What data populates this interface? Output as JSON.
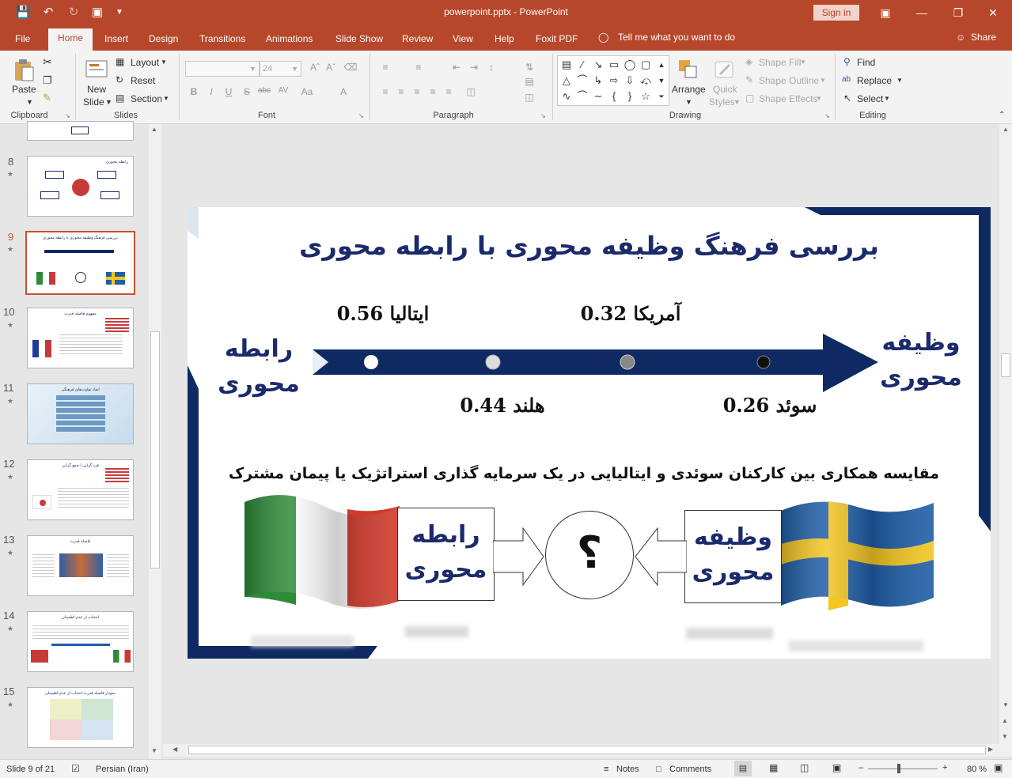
{
  "window": {
    "title": "powerpoint.pptx  -  PowerPoint",
    "signin_label": "Sign in"
  },
  "tabs": [
    "File",
    "Home",
    "Insert",
    "Design",
    "Transitions",
    "Animations",
    "Slide Show",
    "Review",
    "View",
    "Help",
    "Foxit PDF"
  ],
  "active_tab": "Home",
  "tell_me": "Tell me what you want to do",
  "share_label": "Share",
  "ribbon": {
    "clipboard": {
      "label": "Clipboard",
      "paste": "Paste"
    },
    "slides": {
      "label": "Slides",
      "new_slide_line1": "New",
      "new_slide_line2": "Slide",
      "layout": "Layout",
      "reset": "Reset",
      "section": "Section"
    },
    "font": {
      "label": "Font",
      "size": "24"
    },
    "paragraph": {
      "label": "Paragraph"
    },
    "drawing": {
      "label": "Drawing",
      "arrange": "Arrange",
      "quick_styles_line1": "Quick",
      "quick_styles_line2": "Styles",
      "shape_fill": "Shape Fill",
      "shape_outline": "Shape Outline",
      "shape_effects": "Shape Effects"
    },
    "editing": {
      "label": "Editing",
      "find": "Find",
      "replace": "Replace",
      "select": "Select"
    }
  },
  "thumbnails": [
    {
      "num": "8",
      "title": "رابطه محوری"
    },
    {
      "num": "9",
      "title": "بررسی فرهنگ وظیفه محوری با رابطه محوری",
      "selected": true
    },
    {
      "num": "10",
      "title": "مفهوم فاصله قدرت"
    },
    {
      "num": "11",
      "title": "ابعاد تفاوت‌های فرهنگی"
    },
    {
      "num": "12",
      "title": "فرد گرایی / جمع گرایی"
    },
    {
      "num": "13",
      "title": "فاصله قدرت"
    },
    {
      "num": "14",
      "title": "اجتناب از عدم اطمینان"
    },
    {
      "num": "15",
      "title": "نمودار فاصله قدرت-اجتناب از عدم اطمینان"
    }
  ],
  "slide": {
    "title": "بررسی فرهنگ وظیفه محوری با رابطه محوری",
    "left_label_line1": "رابطه",
    "left_label_line2": "محوری",
    "right_label_line1": "وظیفه",
    "right_label_line2": "محوری",
    "italy": "ایتالیا 0.56",
    "america": "آمریکا 0.32",
    "netherlands": "هلند 0.44",
    "sweden": "سوئد 0.26",
    "comparison": "مقایسه همکاری بین کارکنان سوئدی و ایتالیایی در یک سرمایه گذاری استراتژیک یا پیمان مشترک",
    "box_left_line1": "رابطه",
    "box_left_line2": "محوری",
    "box_right_line1": "وظیفه",
    "box_right_line2": "محوری",
    "question": "؟"
  },
  "status": {
    "slide_info": "Slide 9 of 21",
    "language": "Persian (Iran)",
    "notes": "Notes",
    "comments": "Comments",
    "zoom": "80 %"
  },
  "colors": {
    "accent": "#b7472a",
    "slide_navy": "#1b2a6b",
    "arrow_navy": "#0f2a63"
  }
}
